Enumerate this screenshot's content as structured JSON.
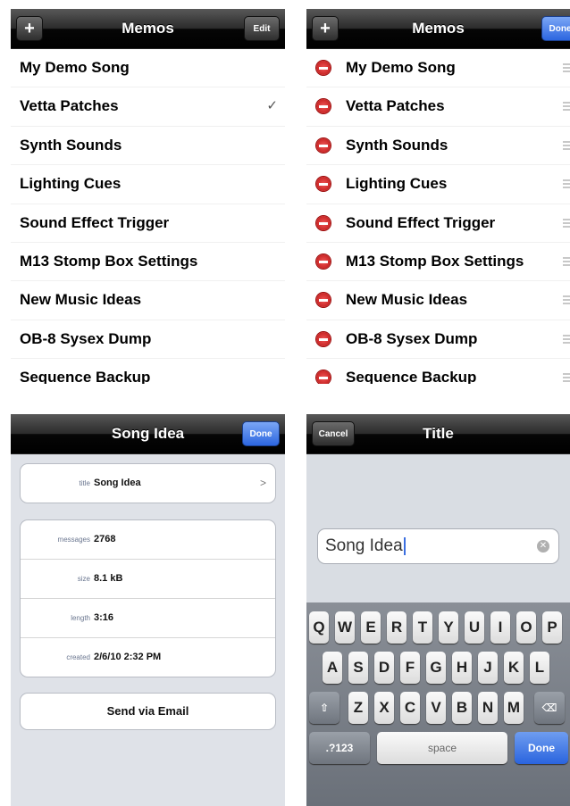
{
  "list_screen": {
    "title": "Memos",
    "add_icon": "+",
    "edit_label": "Edit",
    "checkmark": "✓",
    "items": [
      "My Demo Song",
      "Vetta Patches",
      "Synth Sounds",
      "Lighting Cues",
      "Sound Effect Trigger",
      "M13 Stomp Box Settings",
      "New Music Ideas",
      "OB-8 Sysex Dump",
      "Sequence Backup"
    ]
  },
  "edit_screen": {
    "title": "Memos",
    "add_icon": "+",
    "done_label": "Done"
  },
  "detail_screen": {
    "title": "Song Idea",
    "done_label": "Done",
    "title_key": "title",
    "title_value": "Song Idea",
    "chevron": ">",
    "info": [
      {
        "key": "messages",
        "value": "2768"
      },
      {
        "key": "size",
        "value": "8.1 kB"
      },
      {
        "key": "length",
        "value": "3:16"
      },
      {
        "key": "created",
        "value": "2/6/10 2:32 PM"
      }
    ],
    "email_label": "Send via Email"
  },
  "title_screen": {
    "title": "Title",
    "cancel_label": "Cancel",
    "input_value": "Song Idea",
    "keyboard": {
      "row1": [
        "Q",
        "W",
        "E",
        "R",
        "T",
        "Y",
        "U",
        "I",
        "O",
        "P"
      ],
      "row2": [
        "A",
        "S",
        "D",
        "F",
        "G",
        "H",
        "J",
        "K",
        "L"
      ],
      "row3": [
        "Z",
        "X",
        "C",
        "V",
        "B",
        "N",
        "M"
      ],
      "numbers_label": ".?123",
      "space_label": "space",
      "done_label": "Done"
    }
  }
}
